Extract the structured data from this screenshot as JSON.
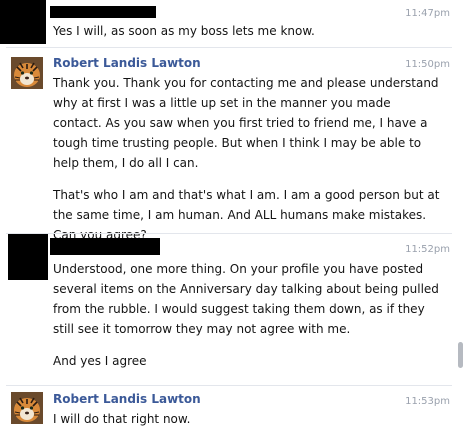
{
  "messages": [
    {
      "sender": "",
      "time": "11:47pm",
      "paragraphs": [
        "Yes I will, as soon as my boss lets me know."
      ]
    },
    {
      "sender": "Robert Landis Lawton",
      "time": "11:50pm",
      "paragraphs": [
        "Thank you.  Thank you for contacting me and please understand why at first I was a little up set in the manner you made contact.  As you saw when you first tried to friend me, I have a tough time trusting people.  But when I think I may be able to help them, I do all I can.",
        "That's who I am and that's what I am.  I am a good person but at the same time, I am human.  And ALL humans make mistakes.  Can you agree?"
      ]
    },
    {
      "sender": "",
      "time": "11:52pm",
      "paragraphs": [
        "Understood, one more thing. On your profile you have posted several items on the Anniversary day talking about being pulled from the rubble. I would suggest taking them down, as if they still see it tomorrow they may not agree with me.",
        "And yes I agree"
      ]
    },
    {
      "sender": "Robert Landis Lawton",
      "time": "11:53pm",
      "paragraphs": [
        "I will do that right now."
      ]
    }
  ],
  "colors": {
    "sender_name": "#3b5998",
    "timestamp": "#9aa1ad",
    "message_text": "#141414",
    "redaction": "#000000"
  },
  "icons": {
    "profile_picture": "tiger-avatar-icon"
  }
}
